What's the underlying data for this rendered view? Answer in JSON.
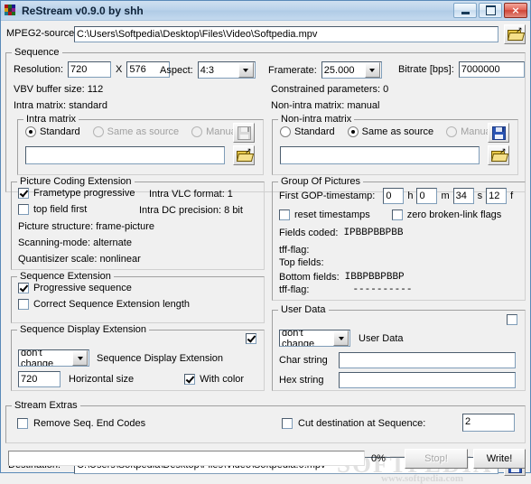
{
  "window": {
    "title": "ReStream v0.9.0 by shh",
    "icon": "app-grid-icon",
    "minimize_label": "Minimize",
    "maximize_label": "Maximize",
    "close_label": "×"
  },
  "source": {
    "label": "MPEG2-source:",
    "value": "C:\\Users\\Softpedia\\Desktop\\Files\\Video\\Softpedia.mpv",
    "browse_icon": "folder-open-icon"
  },
  "sequence": {
    "title": "Sequence",
    "resolution_label": "Resolution:",
    "width": "720",
    "x_label": "X",
    "height": "576",
    "aspect_label": "Aspect:",
    "aspect_value": "4:3",
    "framerate_label": "Framerate:",
    "framerate_value": "25.000",
    "bitrate_label": "Bitrate [bps]:",
    "bitrate_value": "7000000",
    "vbv_label": "VBV buffer size: 112",
    "constrained_label": "Constrained parameters: 0",
    "intra_matrix_label": "Intra matrix: standard",
    "nonintra_matrix_label": "Non-intra matrix: manual",
    "intra_matrix": {
      "title": "Intra matrix",
      "options": [
        "Standard",
        "Same as source",
        "Manual"
      ],
      "selected": "Standard",
      "disabled": [
        "Same as source",
        "Manual"
      ],
      "path_value": "",
      "save_icon": "floppy-save-icon",
      "save_enabled": false,
      "browse_icon": "folder-open-icon"
    },
    "nonintra_matrix": {
      "title": "Non-intra matrix",
      "options": [
        "Standard",
        "Same as source",
        "Manual"
      ],
      "selected": "Same as source",
      "disabled": [
        "Manual"
      ],
      "path_value": "",
      "save_icon": "floppy-save-icon",
      "save_enabled": true,
      "browse_icon": "folder-open-icon"
    }
  },
  "picture_coding_extension": {
    "title": "Picture Coding Extension",
    "frametype_progressive_label": "Frametype progressive",
    "frametype_progressive_checked": true,
    "top_field_first_label": "top field first",
    "top_field_first_checked": false,
    "intra_vlc_label": "Intra VLC format: 1",
    "intra_dc_label": "Intra DC precision: 8 bit",
    "picture_structure_label": "Picture structure: frame-picture",
    "scanning_mode_label": "Scanning-mode: alternate",
    "quantiziser_label": "Quantisizer scale: nonlinear"
  },
  "sequence_extension": {
    "title": "Sequence Extension",
    "progressive_sequence_label": "Progressive sequence",
    "progressive_sequence_checked": true,
    "correct_length_label": "Correct Sequence Extension length",
    "correct_length_checked": false
  },
  "sequence_display_extension": {
    "title": "Sequence Display Extension",
    "enable_checked": true,
    "mode_value": "don't change",
    "mode_label": "Sequence Display Extension",
    "horizontal_size_value": "720",
    "horizontal_size_label": "Horizontal size",
    "with_color_label": "With color",
    "with_color_checked": true
  },
  "group_of_pictures": {
    "title": "Group Of Pictures",
    "first_gop_label": "First GOP-timestamp:",
    "hours": "0",
    "hours_unit": "h",
    "minutes": "0",
    "minutes_unit": "m",
    "seconds": "34",
    "seconds_unit": "s",
    "frames": "12",
    "frames_unit": "f",
    "reset_timestamps_label": "reset timestamps",
    "reset_timestamps_checked": false,
    "zero_broken_link_label": "zero broken-link flags",
    "zero_broken_link_checked": false,
    "fields_coded_label": "Fields coded:",
    "fields_coded_value": "IPBBPBBPBB",
    "tff_flag_label_1": "tff-flag:",
    "tff_flag_value_1": "",
    "top_fields_label": "Top fields:",
    "top_fields_value": "",
    "bottom_fields_label": "Bottom fields:",
    "bottom_fields_value": "IBBPBBPBBP",
    "tff_flag_label_2": "tff-flag:",
    "tff_flag_value_2": "----------"
  },
  "user_data": {
    "title": "User Data",
    "enable_checked": false,
    "mode_value": "don't change",
    "mode_label": "User Data",
    "char_string_label": "Char string",
    "char_string_value": "",
    "hex_string_label": "Hex string",
    "hex_string_value": ""
  },
  "stream_extras": {
    "title": "Stream Extras",
    "remove_seq_end_label": "Remove Seq. End Codes",
    "remove_seq_end_checked": false,
    "cut_destination_label": "Cut destination at Sequence:",
    "cut_destination_checked": false,
    "cut_destination_value": "2"
  },
  "destination": {
    "label": "Destination:",
    "value": "C:\\Users\\Softpedia\\Desktop\\Files\\Video\\Softpedia.0.mpv",
    "save_icon": "floppy-save-icon"
  },
  "footer": {
    "progress_percent": "0%",
    "progress_value": 0,
    "stop_label": "Stop!",
    "stop_enabled": false,
    "write_label": "Write!",
    "write_enabled": true
  },
  "watermark": {
    "big": "SOFTPEDIA",
    "small": "www.softpedia.com"
  },
  "colors": {
    "window_bg": "#f0f0f0",
    "titlebar": "#b9d2ea",
    "field_bg": "#ffffff",
    "field_border": "#7f9db9",
    "close_button": "#cf4436",
    "folder_icon": "#e8c84a",
    "floppy_enabled": "#2b55b4",
    "floppy_disabled": "#d8d8d8"
  }
}
